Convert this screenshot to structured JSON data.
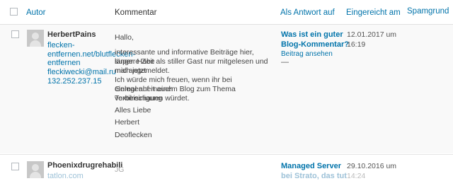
{
  "header": {
    "author": "Autor",
    "comment": "Kommentar",
    "in_response_to": "Als Antwort auf",
    "submitted": "Eingereicht am",
    "spam_reason": "Spamgrund"
  },
  "comments": [
    {
      "author_name": "HerbertPains",
      "author_url_lines": [
        "flecken-",
        "entfernen.net/blutflecken-",
        "entfernen"
      ],
      "author_email": "fleckiwecki@mail.ru",
      "author_ip": "132.252.237.15",
      "comment_lines": [
        "Hallo,",
        "interessante und informative Beiträge hier, super. Habe",
        "längere Zeit als stiller Gast nur mitgelesen und mich jetzt",
        "mal angemeldet.",
        "Ich würde mich freuen, wenn ihr bei Gelegenheit auch",
        "einmal auf meinem Blog zum Thema Textilreinigung",
        "vorbeischauen würdet.",
        "Alles Liebe",
        "Herbert"
      ],
      "comment_link": "Deoflecken",
      "post_title_lines": [
        "Was ist ein guter",
        "Blog-Kommentar?"
      ],
      "view_post": "Beitrag ansehen",
      "count": "—",
      "date": "12.01.2017 um",
      "time": "16:19"
    },
    {
      "author_name": "Phoenixdrugrehabili",
      "author_url_partial": "tatlon.com",
      "comment_partial": "JG",
      "post_title_lines": [
        "Managed Server",
        "bei Strato, das tut"
      ],
      "date": "29.10.2016 um",
      "time": "14:24"
    }
  ]
}
